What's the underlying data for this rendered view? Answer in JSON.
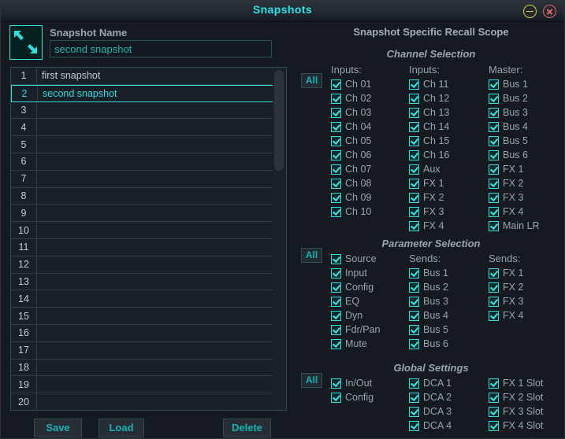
{
  "window": {
    "title": "Snapshots",
    "minimize_icon": "minimize-icon",
    "close_icon": "close-icon"
  },
  "left": {
    "snapshot_icon": "collapse-arrows-icon",
    "name_label": "Snapshot Name",
    "name_value": "second snapshot",
    "name_placeholder": "Snapshot Name",
    "rows": [
      {
        "num": "1",
        "value": "first snapshot",
        "selected": false
      },
      {
        "num": "2",
        "value": "second snapshot",
        "selected": true
      },
      {
        "num": "3",
        "value": "",
        "selected": false
      },
      {
        "num": "4",
        "value": "",
        "selected": false
      },
      {
        "num": "5",
        "value": "",
        "selected": false
      },
      {
        "num": "6",
        "value": "",
        "selected": false
      },
      {
        "num": "7",
        "value": "",
        "selected": false
      },
      {
        "num": "8",
        "value": "",
        "selected": false
      },
      {
        "num": "9",
        "value": "",
        "selected": false
      },
      {
        "num": "10",
        "value": "",
        "selected": false
      },
      {
        "num": "11",
        "value": "",
        "selected": false
      },
      {
        "num": "12",
        "value": "",
        "selected": false
      },
      {
        "num": "13",
        "value": "",
        "selected": false
      },
      {
        "num": "14",
        "value": "",
        "selected": false
      },
      {
        "num": "15",
        "value": "",
        "selected": false
      },
      {
        "num": "16",
        "value": "",
        "selected": false
      },
      {
        "num": "17",
        "value": "",
        "selected": false
      },
      {
        "num": "18",
        "value": "",
        "selected": false
      },
      {
        "num": "19",
        "value": "",
        "selected": false
      },
      {
        "num": "20",
        "value": "",
        "selected": false
      }
    ],
    "buttons": {
      "save": "Save",
      "load": "Load",
      "delete": "Delete"
    }
  },
  "right": {
    "panel_title": "Snapshot Specific Recall Scope",
    "all_label": "All",
    "sections": [
      {
        "title": "Channel Selection",
        "columns": [
          {
            "head": "Inputs:",
            "items": [
              {
                "label": "Ch 01",
                "checked": true
              },
              {
                "label": "Ch 02",
                "checked": true
              },
              {
                "label": "Ch 03",
                "checked": true
              },
              {
                "label": "Ch 04",
                "checked": true
              },
              {
                "label": "Ch 05",
                "checked": true
              },
              {
                "label": "Ch 06",
                "checked": true
              },
              {
                "label": "Ch 07",
                "checked": true
              },
              {
                "label": "Ch 08",
                "checked": true
              },
              {
                "label": "Ch 09",
                "checked": true
              },
              {
                "label": "Ch 10",
                "checked": true
              }
            ]
          },
          {
            "head": "Inputs:",
            "items": [
              {
                "label": "Ch 11",
                "checked": true
              },
              {
                "label": "Ch 12",
                "checked": true
              },
              {
                "label": "Ch 13",
                "checked": true
              },
              {
                "label": "Ch 14",
                "checked": true
              },
              {
                "label": "Ch 15",
                "checked": true
              },
              {
                "label": "Ch 16",
                "checked": true
              },
              {
                "label": "Aux",
                "checked": true
              },
              {
                "label": "FX 1",
                "checked": true
              },
              {
                "label": "FX 2",
                "checked": true
              },
              {
                "label": "FX 3",
                "checked": true
              },
              {
                "label": "FX 4",
                "checked": true
              }
            ]
          },
          {
            "head": "Master:",
            "items": [
              {
                "label": "Bus 1",
                "checked": true
              },
              {
                "label": "Bus 2",
                "checked": true
              },
              {
                "label": "Bus 3",
                "checked": true
              },
              {
                "label": "Bus 4",
                "checked": true
              },
              {
                "label": "Bus 5",
                "checked": true
              },
              {
                "label": "Bus 6",
                "checked": true
              },
              {
                "label": "FX 1",
                "checked": true
              },
              {
                "label": "FX 2",
                "checked": true
              },
              {
                "label": "FX 3",
                "checked": true
              },
              {
                "label": "FX 4",
                "checked": true
              },
              {
                "label": "Main LR",
                "checked": true
              }
            ]
          }
        ]
      },
      {
        "title": "Parameter Selection",
        "columns": [
          {
            "head": "",
            "items": [
              {
                "label": "Source",
                "checked": true
              },
              {
                "label": "Input",
                "checked": true
              },
              {
                "label": "Config",
                "checked": true
              },
              {
                "label": "EQ",
                "checked": true
              },
              {
                "label": "Dyn",
                "checked": true
              },
              {
                "label": "Fdr/Pan",
                "checked": true
              },
              {
                "label": "Mute",
                "checked": true
              }
            ]
          },
          {
            "head": "Sends:",
            "items": [
              {
                "label": "Bus 1",
                "checked": true
              },
              {
                "label": "Bus 2",
                "checked": true
              },
              {
                "label": "Bus 3",
                "checked": true
              },
              {
                "label": "Bus 4",
                "checked": true
              },
              {
                "label": "Bus 5",
                "checked": true
              },
              {
                "label": "Bus 6",
                "checked": true
              }
            ]
          },
          {
            "head": "Sends:",
            "items": [
              {
                "label": "FX 1",
                "checked": true
              },
              {
                "label": "FX 2",
                "checked": true
              },
              {
                "label": "FX 3",
                "checked": true
              },
              {
                "label": "FX 4",
                "checked": true
              }
            ]
          }
        ]
      },
      {
        "title": "Global Settings",
        "columns": [
          {
            "head": "",
            "items": [
              {
                "label": "In/Out",
                "checked": true
              },
              {
                "label": "Config",
                "checked": true
              }
            ]
          },
          {
            "head": "",
            "items": [
              {
                "label": "DCA 1",
                "checked": true
              },
              {
                "label": "DCA 2",
                "checked": true
              },
              {
                "label": "DCA 3",
                "checked": true
              },
              {
                "label": "DCA 4",
                "checked": true
              }
            ]
          },
          {
            "head": "",
            "items": [
              {
                "label": "FX 1 Slot",
                "checked": true
              },
              {
                "label": "FX 2 Slot",
                "checked": true
              },
              {
                "label": "FX 3 Slot",
                "checked": true
              },
              {
                "label": "FX 4 Slot",
                "checked": true
              }
            ]
          }
        ]
      }
    ]
  },
  "colors": {
    "accent_cyan": "#2fe0df",
    "title_cyan": "#29e3e8",
    "button_teal": "#17b3b0",
    "label_gray": "#9aa4ad",
    "bg_dark": "#151a21",
    "close_red": "#e06a6a",
    "minimize_yellow": "#d6cf3c"
  }
}
